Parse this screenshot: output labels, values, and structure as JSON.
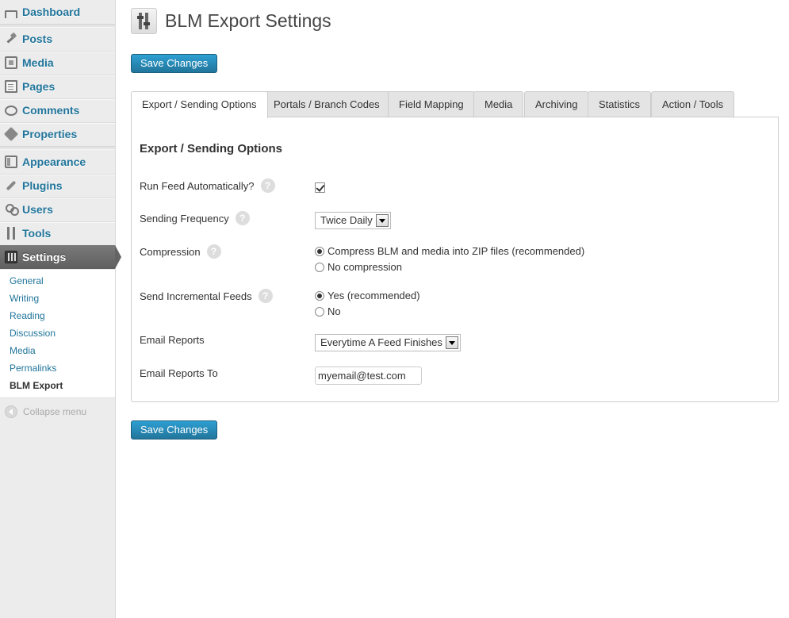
{
  "sidebar": {
    "menu": [
      {
        "label": "Dashboard",
        "icon": "dashboard-icon"
      },
      {
        "label": "Posts",
        "icon": "posts-pin-icon"
      },
      {
        "label": "Media",
        "icon": "media-icon"
      },
      {
        "label": "Pages",
        "icon": "pages-icon"
      },
      {
        "label": "Comments",
        "icon": "comments-icon"
      },
      {
        "label": "Properties",
        "icon": "properties-icon"
      },
      {
        "label": "Appearance",
        "icon": "appearance-icon"
      },
      {
        "label": "Plugins",
        "icon": "plugins-icon"
      },
      {
        "label": "Users",
        "icon": "users-icon"
      },
      {
        "label": "Tools",
        "icon": "tools-icon"
      },
      {
        "label": "Settings",
        "icon": "settings-icon"
      }
    ],
    "submenu": [
      "General",
      "Writing",
      "Reading",
      "Discussion",
      "Media",
      "Permalinks",
      "BLM Export"
    ],
    "collapse_label": "Collapse menu"
  },
  "header": {
    "title": "BLM Export Settings"
  },
  "buttons": {
    "save_top": "Save Changes",
    "save_bottom": "Save Changes"
  },
  "tabs": [
    "Export / Sending Options",
    "Portals / Branch Codes",
    "Field Mapping",
    "Media",
    "Archiving",
    "Statistics",
    "Action / Tools"
  ],
  "panel": {
    "title": "Export / Sending Options",
    "run_feed": {
      "label": "Run Feed Automatically?",
      "checked": true
    },
    "frequency": {
      "label": "Sending Frequency",
      "value": "Twice Daily"
    },
    "compression": {
      "label": "Compression",
      "options": [
        "Compress BLM and media into ZIP files (recommended)",
        "No compression"
      ],
      "selected": 0
    },
    "incremental": {
      "label": "Send Incremental Feeds",
      "options": [
        "Yes (recommended)",
        "No"
      ],
      "selected": 0
    },
    "email_reports": {
      "label": "Email Reports",
      "value": "Everytime A Feed Finishes"
    },
    "email_to": {
      "label": "Email Reports To",
      "value": "myemail@test.com"
    },
    "help_glyph": "?"
  },
  "colors": {
    "link": "#21759b",
    "button": "#21759b",
    "sidebar_bg": "#ececec",
    "current_menu": "#6d6d6d"
  }
}
